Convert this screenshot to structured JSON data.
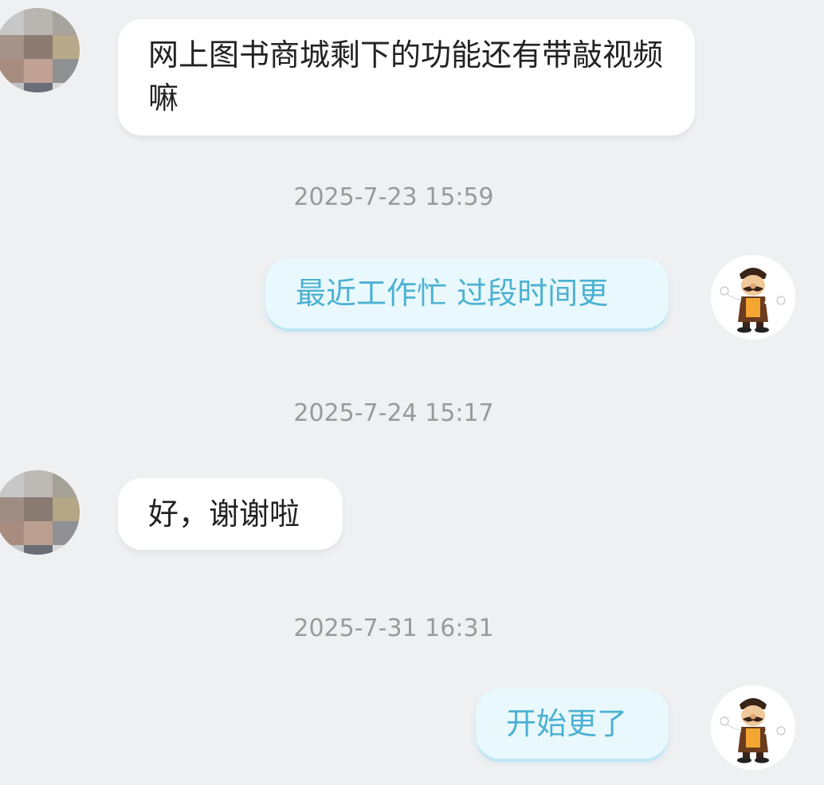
{
  "conversation": {
    "messages": [
      {
        "side": "in",
        "text": "网上图书商城剩下的功能还有带敲视频嘛"
      },
      {
        "side": "out",
        "text": "最近工作忙 过段时间更"
      },
      {
        "side": "in",
        "text": "好，谢谢啦"
      },
      {
        "side": "out",
        "text": "开始更了"
      }
    ],
    "timestamps": [
      "2025-7-23 15:59",
      "2025-7-24 15:17",
      "2025-7-31 16:31"
    ]
  },
  "colors": {
    "background": "#eff0f2",
    "incoming_bubble": "#ffffff",
    "outgoing_bubble": "#e9f8fc",
    "outgoing_text": "#4cb1d2",
    "timestamp_text": "#9a9a9a"
  },
  "icons": {
    "other_avatar": "pixelated-avatar-icon",
    "my_avatar": "cartoon-chef-avatar-icon"
  }
}
